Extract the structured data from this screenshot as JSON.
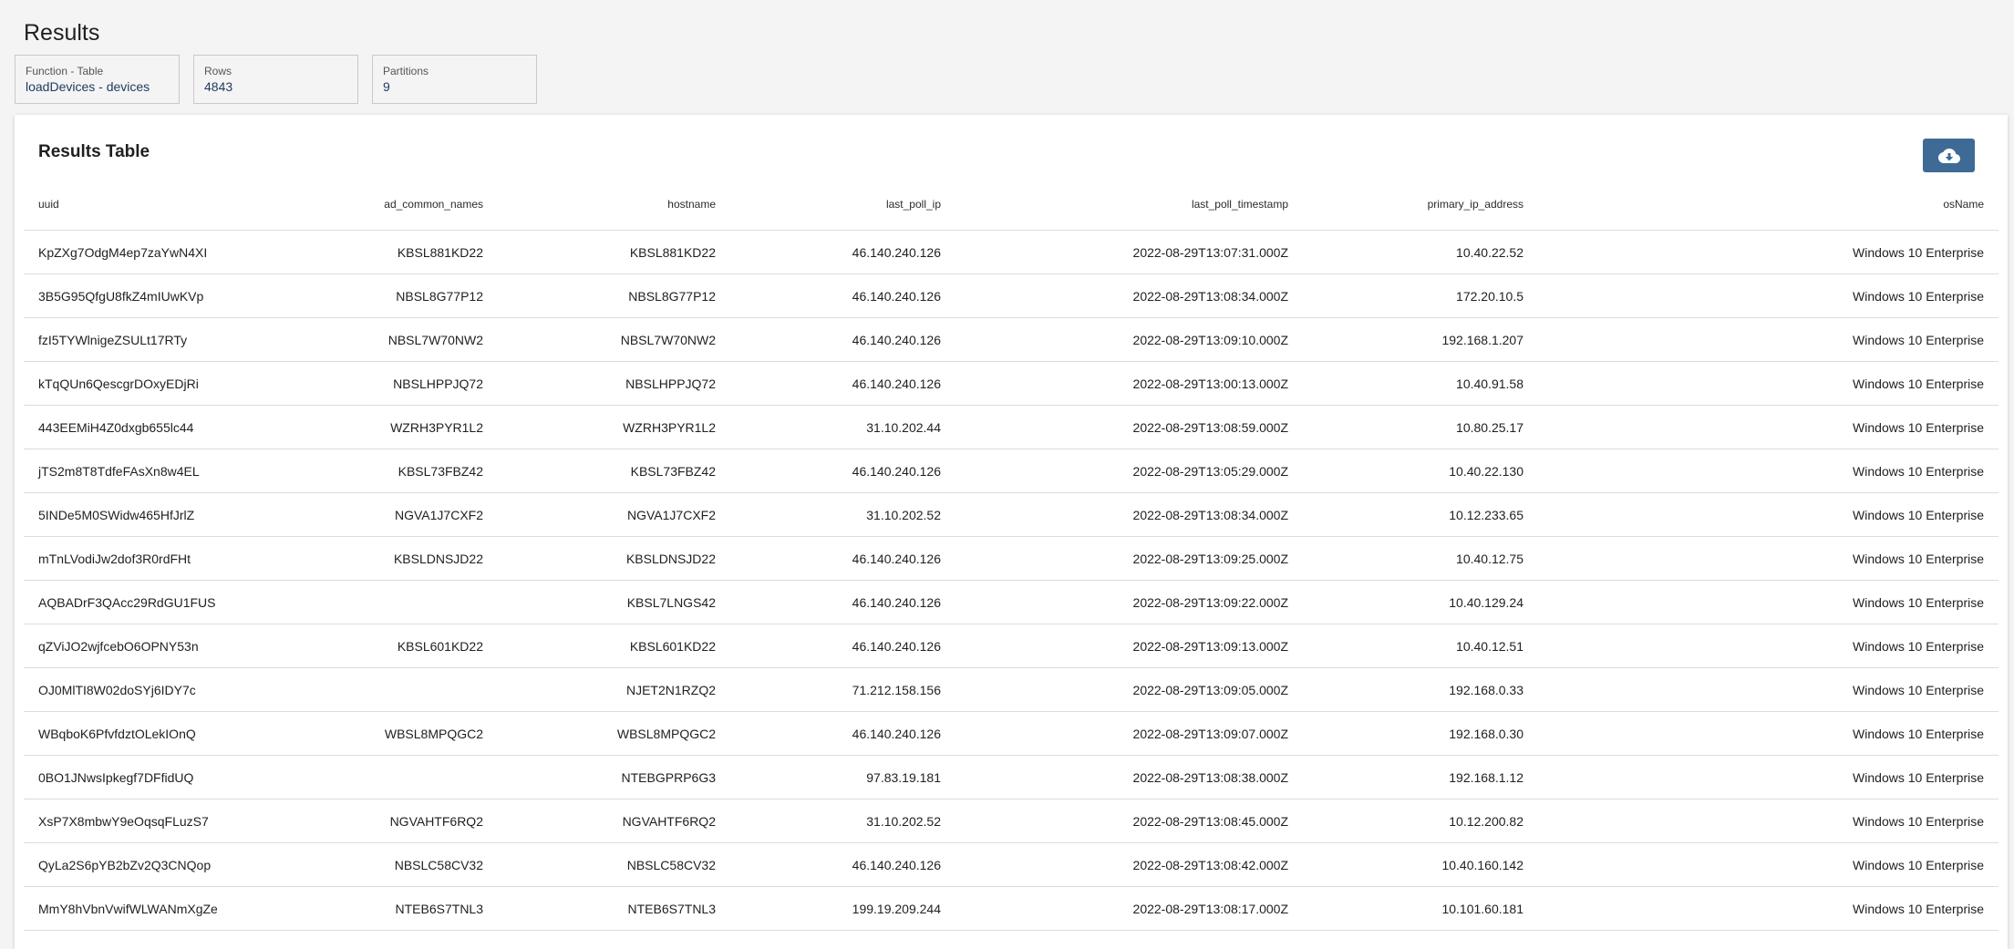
{
  "page": {
    "title": "Results"
  },
  "stats": [
    {
      "label": "Function - Table",
      "value": "loadDevices - devices"
    },
    {
      "label": "Rows",
      "value": "4843"
    },
    {
      "label": "Partitions",
      "value": "9"
    }
  ],
  "results_table": {
    "title": "Results Table",
    "download_icon": "cloud-download-icon",
    "accent_color": "#3e6b95",
    "columns": [
      "uuid",
      "ad_common_names",
      "hostname",
      "last_poll_ip",
      "last_poll_timestamp",
      "primary_ip_address",
      "osName"
    ],
    "rows": [
      [
        "KpZXg7OdgM4ep7zaYwN4XI",
        "KBSL881KD22",
        "KBSL881KD22",
        "46.140.240.126",
        "2022-08-29T13:07:31.000Z",
        "10.40.22.52",
        "Windows 10 Enterprise"
      ],
      [
        "3B5G95QfgU8fkZ4mIUwKVp",
        "NBSL8G77P12",
        "NBSL8G77P12",
        "46.140.240.126",
        "2022-08-29T13:08:34.000Z",
        "172.20.10.5",
        "Windows 10 Enterprise"
      ],
      [
        "fzI5TYWlnigeZSULt17RTy",
        "NBSL7W70NW2",
        "NBSL7W70NW2",
        "46.140.240.126",
        "2022-08-29T13:09:10.000Z",
        "192.168.1.207",
        "Windows 10 Enterprise"
      ],
      [
        "kTqQUn6QescgrDOxyEDjRi",
        "NBSLHPPJQ72",
        "NBSLHPPJQ72",
        "46.140.240.126",
        "2022-08-29T13:00:13.000Z",
        "10.40.91.58",
        "Windows 10 Enterprise"
      ],
      [
        "443EEMiH4Z0dxgb655lc44",
        "WZRH3PYR1L2",
        "WZRH3PYR1L2",
        "31.10.202.44",
        "2022-08-29T13:08:59.000Z",
        "10.80.25.17",
        "Windows 10 Enterprise"
      ],
      [
        "jTS2m8T8TdfeFAsXn8w4EL",
        "KBSL73FBZ42",
        "KBSL73FBZ42",
        "46.140.240.126",
        "2022-08-29T13:05:29.000Z",
        "10.40.22.130",
        "Windows 10 Enterprise"
      ],
      [
        "5INDe5M0SWidw465HfJrlZ",
        "NGVA1J7CXF2",
        "NGVA1J7CXF2",
        "31.10.202.52",
        "2022-08-29T13:08:34.000Z",
        "10.12.233.65",
        "Windows 10 Enterprise"
      ],
      [
        "mTnLVodiJw2dof3R0rdFHt",
        "KBSLDNSJD22",
        "KBSLDNSJD22",
        "46.140.240.126",
        "2022-08-29T13:09:25.000Z",
        "10.40.12.75",
        "Windows 10 Enterprise"
      ],
      [
        "AQBADrF3QAcc29RdGU1FUS",
        "",
        "KBSL7LNGS42",
        "46.140.240.126",
        "2022-08-29T13:09:22.000Z",
        "10.40.129.24",
        "Windows 10 Enterprise"
      ],
      [
        "qZViJO2wjfcebO6OPNY53n",
        "KBSL601KD22",
        "KBSL601KD22",
        "46.140.240.126",
        "2022-08-29T13:09:13.000Z",
        "10.40.12.51",
        "Windows 10 Enterprise"
      ],
      [
        "OJ0MlTI8W02doSYj6IDY7c",
        "",
        "NJET2N1RZQ2",
        "71.212.158.156",
        "2022-08-29T13:09:05.000Z",
        "192.168.0.33",
        "Windows 10 Enterprise"
      ],
      [
        "WBqboK6PfvfdztOLekIOnQ",
        "WBSL8MPQGC2",
        "WBSL8MPQGC2",
        "46.140.240.126",
        "2022-08-29T13:09:07.000Z",
        "192.168.0.30",
        "Windows 10 Enterprise"
      ],
      [
        "0BO1JNwsIpkegf7DFfidUQ",
        "",
        "NTEBGPRP6G3",
        "97.83.19.181",
        "2022-08-29T13:08:38.000Z",
        "192.168.1.12",
        "Windows 10 Enterprise"
      ],
      [
        "XsP7X8mbwY9eOqsqFLuzS7",
        "NGVAHTF6RQ2",
        "NGVAHTF6RQ2",
        "31.10.202.52",
        "2022-08-29T13:08:45.000Z",
        "10.12.200.82",
        "Windows 10 Enterprise"
      ],
      [
        "QyLa2S6pYB2bZv2Q3CNQop",
        "NBSLC58CV32",
        "NBSLC58CV32",
        "46.140.240.126",
        "2022-08-29T13:08:42.000Z",
        "10.40.160.142",
        "Windows 10 Enterprise"
      ],
      [
        "MmY8hVbnVwifWLWANmXgZe",
        "NTEB6S7TNL3",
        "NTEB6S7TNL3",
        "199.19.209.244",
        "2022-08-29T13:08:17.000Z",
        "10.101.60.181",
        "Windows 10 Enterprise"
      ]
    ]
  }
}
